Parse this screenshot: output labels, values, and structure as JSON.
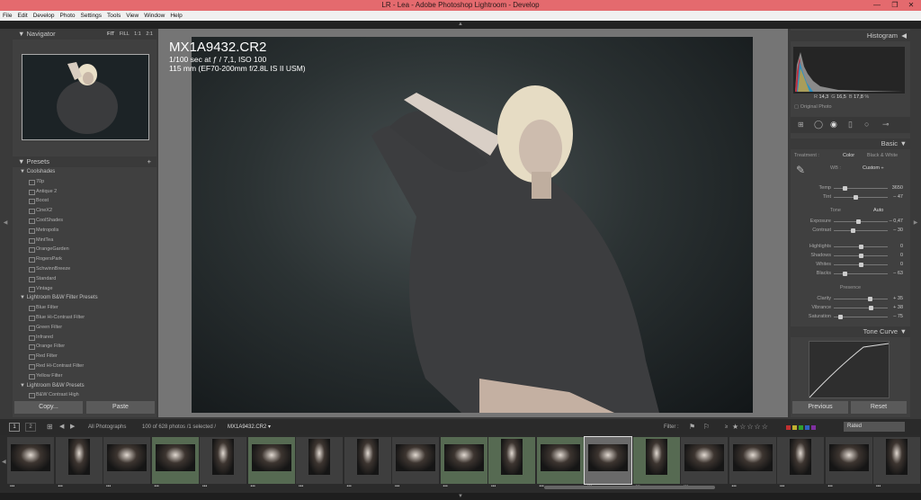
{
  "window": {
    "title": "LR - Lea - Adobe Photoshop Lightroom - Develop",
    "minimize": "—",
    "maximize": "❐",
    "close": "✕"
  },
  "menu": [
    "File",
    "Edit",
    "Develop",
    "Photo",
    "Settings",
    "Tools",
    "View",
    "Window",
    "Help"
  ],
  "navigator": {
    "title": "Navigator",
    "zoom_options": [
      "FIT",
      "FILL",
      "1:1",
      "2:1"
    ]
  },
  "presets": {
    "title": "Presets",
    "add": "+",
    "folders": [
      {
        "name": "Coolshades",
        "items": [
          "70p",
          "Antique 2",
          "Boost",
          "CineX2",
          "CoolShades",
          "Metropolis",
          "MintTea",
          "OrangeGarden",
          "RogersPark",
          "SchwinnBreeze",
          "Standard",
          "Vintage"
        ]
      },
      {
        "name": "Lightroom B&W Filter Presets",
        "items": [
          "Blue Filter",
          "Blue Hi-Contrast Filter",
          "Green Filter",
          "Infrared",
          "Orange Filter",
          "Red Filter",
          "Red Hi-Contrast Filter",
          "Yellow Filter"
        ]
      },
      {
        "name": "Lightroom B&W Presets",
        "items": [
          "B&W Contrast High"
        ]
      }
    ],
    "copy": "Copy...",
    "paste": "Paste"
  },
  "photo_info": {
    "filename": "MX1A9432.CR2",
    "exposure": "1/100 sec at ƒ / 7,1, ISO 100",
    "lens": "115 mm (EF70-200mm f/2.8L IS II USM)"
  },
  "histogram": {
    "title": "Histogram",
    "r_label": "R",
    "r": "14,3",
    "g_label": "G",
    "g": "16,5",
    "b_label": "B",
    "b": "17,8",
    "pct": "%",
    "original": "Original Photo"
  },
  "basic": {
    "title": "Basic",
    "treatment_label": "Treatment :",
    "color": "Color",
    "bw": "Black & White",
    "wb_label": "WB :",
    "wb_value": "Custom ÷",
    "sliders1": [
      {
        "label": "Temp",
        "value": "3650",
        "pos": 0.2
      },
      {
        "label": "Tint",
        "value": "– 47",
        "pos": 0.4
      }
    ],
    "tone_label": "Tone",
    "auto": "Auto",
    "sliders2": [
      {
        "label": "Exposure",
        "value": "– 0,47",
        "pos": 0.45
      },
      {
        "label": "Contrast",
        "value": "– 30",
        "pos": 0.35
      }
    ],
    "sliders3": [
      {
        "label": "Highlights",
        "value": "0",
        "pos": 0.5
      },
      {
        "label": "Shadows",
        "value": "0",
        "pos": 0.5
      },
      {
        "label": "Whites",
        "value": "0",
        "pos": 0.5
      },
      {
        "label": "Blacks",
        "value": "– 63",
        "pos": 0.2
      }
    ],
    "presence_label": "Presence",
    "sliders4": [
      {
        "label": "Clarity",
        "value": "+ 35",
        "pos": 0.67
      },
      {
        "label": "Vibrance",
        "value": "+ 38",
        "pos": 0.69
      },
      {
        "label": "Saturation",
        "value": "– 75",
        "pos": 0.12
      }
    ]
  },
  "tone_curve": {
    "title": "Tone Curve"
  },
  "right_buttons": {
    "previous": "Previous",
    "reset": "Reset"
  },
  "filmbar": {
    "source": "All Photographs",
    "count": "100 of 628 photos /1 selected /",
    "file": "MX1A9432.CR2 ▾",
    "filter": "Filter :",
    "rated_cmp": "≥",
    "stars": "★☆☆☆☆",
    "rated": "Rated"
  },
  "filmstrip": {
    "count": 19
  },
  "colors": {
    "titlebar": "#e46a6e",
    "panel": "#404040",
    "selected_cell": "#566a52"
  }
}
